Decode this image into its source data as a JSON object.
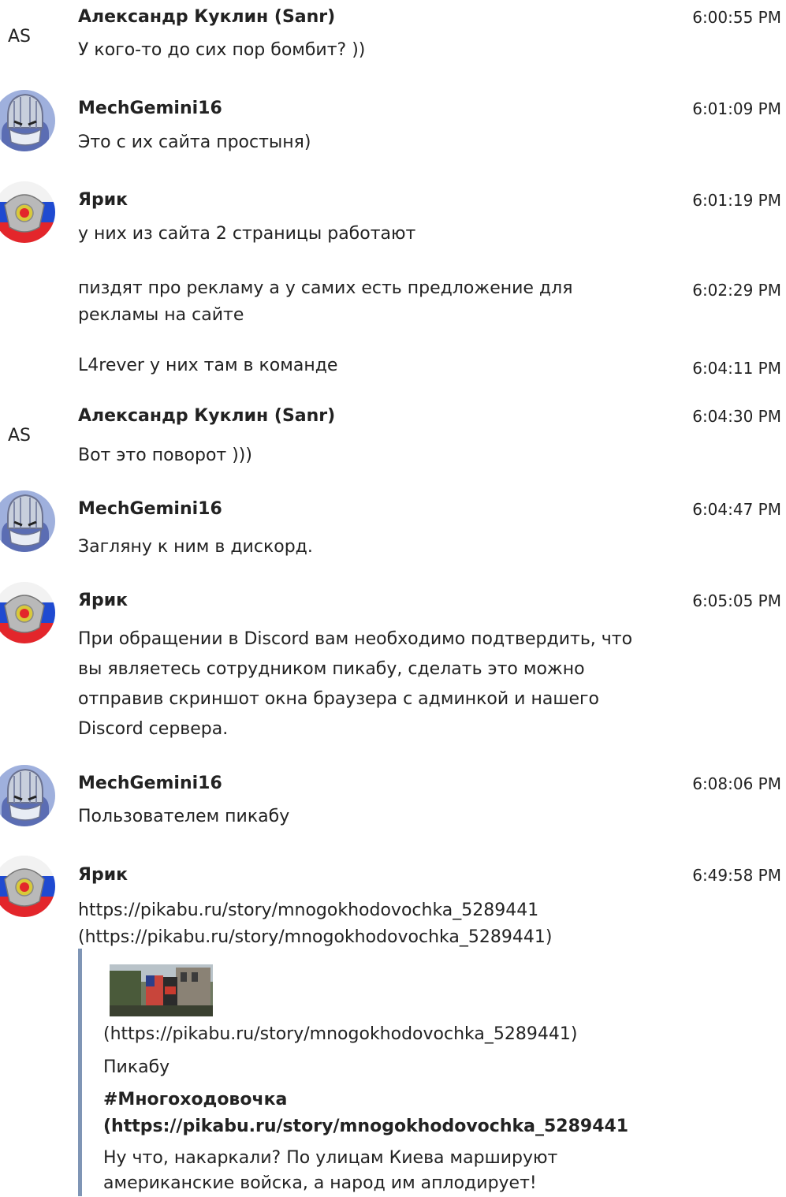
{
  "messages": [
    {
      "avatar_text": "AS",
      "author": "Александр Куклин (Sanr)",
      "time": "6:00:55 PM",
      "text": "У кого-то до сих пор бомбит? ))"
    },
    {
      "author": "MechGemini16",
      "time": "6:01:09 PM",
      "text": "Это с их сайта простыня)"
    },
    {
      "author": "Ярик",
      "time": "6:01:19 PM",
      "text": "у них из сайта 2 страницы работают"
    },
    {
      "time": "6:02:29 PM",
      "text": "пиздят про рекламу а у самих есть предложение для рекламы на сайте"
    },
    {
      "time": "6:04:11 PM",
      "text": "L4rever у них там в команде"
    },
    {
      "avatar_text": "AS",
      "author": "Александр Куклин (Sanr)",
      "time": "6:04:30 PM",
      "text": "Вот это поворот )))"
    },
    {
      "author": "MechGemini16",
      "time": "6:04:47 PM",
      "text": "Загляну к ним в дискорд."
    },
    {
      "author": "Ярик",
      "time": "6:05:05 PM",
      "text": "При обращении в Discord вам необходимо подтвердить, что вы являетесь сотрудником пикабу, сделать это можно отправив скриншот окна браузера с админкой и нашего Discord сервера."
    },
    {
      "author": "MechGemini16",
      "time": "6:08:06 PM",
      "text": "Пользователем пикабу"
    },
    {
      "author": "Ярик",
      "time": "6:49:58 PM",
      "text": "https://pikabu.ru/story/mnogokhodovochka_5289441 (https://pikabu.ru/story/mnogokhodovochka_5289441)"
    }
  ],
  "embed": {
    "thumb_link": "(https://pikabu.ru/story/mnogokhodovochka_5289441)",
    "site": "Пикабу",
    "title_line1": "#Многоходовочка",
    "title_line2": "(https://pikabu.ru/story/mnogokhodovochka_5289441",
    "desc_line1": "Ну что, накаркали? По улицам Киева маршируют",
    "desc_line2": "американские войска, а народ им аплодирует!"
  },
  "colors": {
    "embed_border": "#7f95b5",
    "text": "#222222",
    "flag_white": "#ffffff",
    "flag_blue": "#1f4ad1",
    "flag_red": "#e3262b",
    "shredder_blue": "#5b6db3",
    "shredder_silver": "#c8cfdc"
  }
}
